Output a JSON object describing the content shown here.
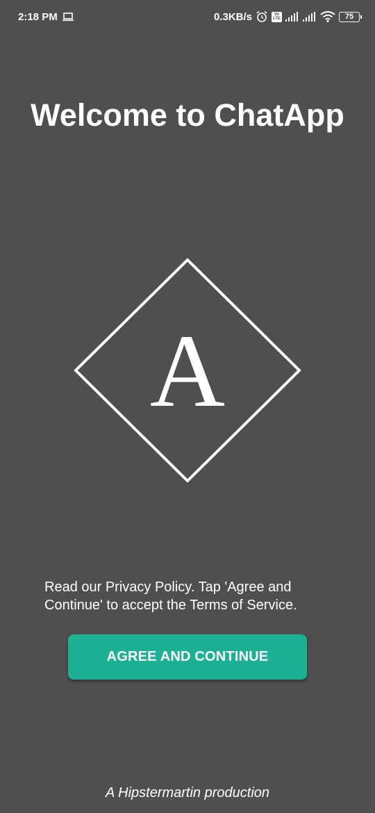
{
  "status_bar": {
    "time": "2:18 PM",
    "net_speed": "0.3KB/s",
    "battery": "75",
    "volte_top": "Vo",
    "volte_bottom": "LTE",
    "icons": [
      "laptop-icon",
      "alarm-icon",
      "volte-icon",
      "signal-icon",
      "signal-icon",
      "wifi-icon",
      "battery-icon"
    ]
  },
  "welcome": {
    "title": "Welcome to ChatApp"
  },
  "logo": {
    "letter": "A",
    "icon": "diamond-logo-icon"
  },
  "policy_text": "Read our Privacy Policy. Tap 'Agree and Continue' to accept the Terms of Service.",
  "agree_button": {
    "label": "AGREE AND CONTINUE"
  },
  "footer": "A Hipstermartin production",
  "colors": {
    "background": "#4f4f4f",
    "accent": "#1cb094",
    "text": "#ffffff"
  }
}
